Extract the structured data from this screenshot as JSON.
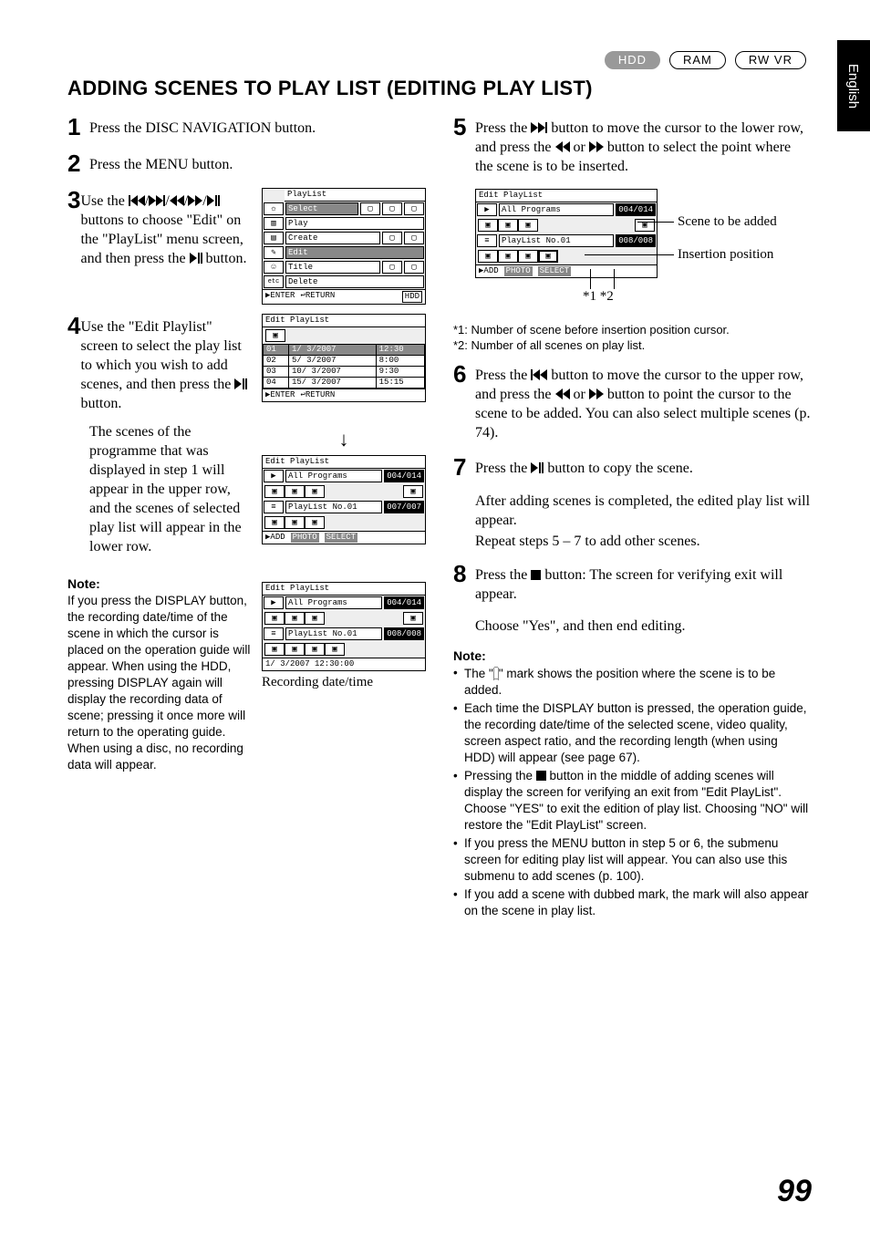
{
  "sideTab": "English",
  "badges": {
    "b1": "HDD",
    "b2": "RAM",
    "b3": "RW VR"
  },
  "heading": "ADDING SCENES TO PLAY LIST (EDITING PLAY LIST)",
  "left": {
    "s1": "Press the DISC NAVIGATION button.",
    "s2": "Press the MENU button.",
    "s3a": "Use the ",
    "s3b": " buttons to choose \"Edit\" on the \"PlayList\" menu screen, and then press the ",
    "s3c": " button.",
    "s4a": "Use the \"Edit Playlist\" screen to select the play list to which you wish to add scenes, and then press the ",
    "s4b": " button.",
    "s4p": "The scenes of the programme that was displayed in step 1 will appear in the upper row, and the scenes of selected play list will appear in the lower row.",
    "noteH": "Note:",
    "note1": "If you press the DISPLAY button, the recording date/time of the scene in which the cursor is placed on the operation guide will appear. When using the HDD, pressing DISPLAY again will display the recording data of scene; pressing it once more will return to the operating guide. When using a disc, no recording data will appear.",
    "recCaption": "Recording date/time"
  },
  "right": {
    "s5a": "Press the ",
    "s5b": " button to move the cursor to the lower row, and press the ",
    "s5c": " or ",
    "s5d": " button to select the point where the scene is to be inserted.",
    "callout1": "Scene to be added",
    "callout2": "Insertion position",
    "stars": "*1     *2",
    "fn1": "*1: Number of scene before insertion position cursor.",
    "fn2": "*2: Number of all scenes on play list.",
    "s6a": "Press the ",
    "s6b": " button to move the cursor to the upper row, and press the ",
    "s6c": " or ",
    "s6d": " button to point the cursor to the scene to be added. You can also select multiple scenes (p. 74).",
    "s7a": "Press the ",
    "s7b": " button to copy the scene.",
    "s7p1": "After adding scenes is completed, the edited play list will appear.",
    "s7p2": "Repeat steps 5 – 7 to add other scenes.",
    "s8a": "Press the ",
    "s8b": " button: The screen for verifying exit will appear.",
    "s8p": "Choose \"Yes\", and then end editing.",
    "noteH": "Note:",
    "nb1a": "The \"",
    "nb1b": "\" mark shows the position where the scene is to be added.",
    "nb2": "Each time the DISPLAY button is pressed, the operation guide, the recording date/time of the selected scene, video quality, screen aspect ratio, and the recording length (when using HDD) will appear (see page 67).",
    "nb3a": "Pressing the ",
    "nb3b": " button in the middle of adding scenes will display the screen for verifying an exit from \"Edit PlayList\". Choose \"YES\" to exit the edition of play list. Choosing \"NO\" will restore the \"Edit PlayList\" screen.",
    "nb4": "If you press the MENU button in step 5 or 6, the submenu screen for editing play list will appear. You can also use this submenu to add scenes (p. 100).",
    "nb5": "If you add a scene with dubbed mark, the mark will also appear on the scene in play list."
  },
  "shots": {
    "menu": {
      "title": "PlayList",
      "items": [
        "Select",
        "Play",
        "Create",
        "Edit",
        "Title",
        "Delete"
      ],
      "etc": "etc",
      "footerL": "ENTER",
      "footerR": "RETURN",
      "disc": "HDD"
    },
    "list": {
      "title": "Edit PlayList",
      "rows": [
        {
          "no": "01",
          "date": "1/ 3/2007",
          "time": "12:30",
          "hl": true
        },
        {
          "no": "02",
          "date": "5/ 3/2007",
          "time": "8:00"
        },
        {
          "no": "03",
          "date": "10/ 3/2007",
          "time": "9:30"
        },
        {
          "no": "04",
          "date": "15/ 3/2007",
          "time": "15:15"
        }
      ],
      "footerL": "ENTER",
      "footerR": "RETURN"
    },
    "edit1": {
      "title": "Edit PlayList",
      "top": "All Programs",
      "topCount": "004/014",
      "mid": "PlayList No.01",
      "midCount": "007/007",
      "footer": [
        "ADD",
        "PHOTO",
        "SELECT"
      ]
    },
    "edit2": {
      "title": "Edit PlayList",
      "top": "All Programs",
      "topCount": "004/014",
      "mid": "PlayList No.01",
      "midCount": "008/008",
      "date": "1/ 3/2007 12:30:00"
    },
    "edit3": {
      "title": "Edit PlayList",
      "top": "All Programs",
      "topCount": "004/014",
      "mid": "PlayList No.01",
      "midCount": "008/008",
      "footer": [
        "ADD",
        "PHOTO",
        "SELECT"
      ]
    }
  },
  "pagenum": "99"
}
